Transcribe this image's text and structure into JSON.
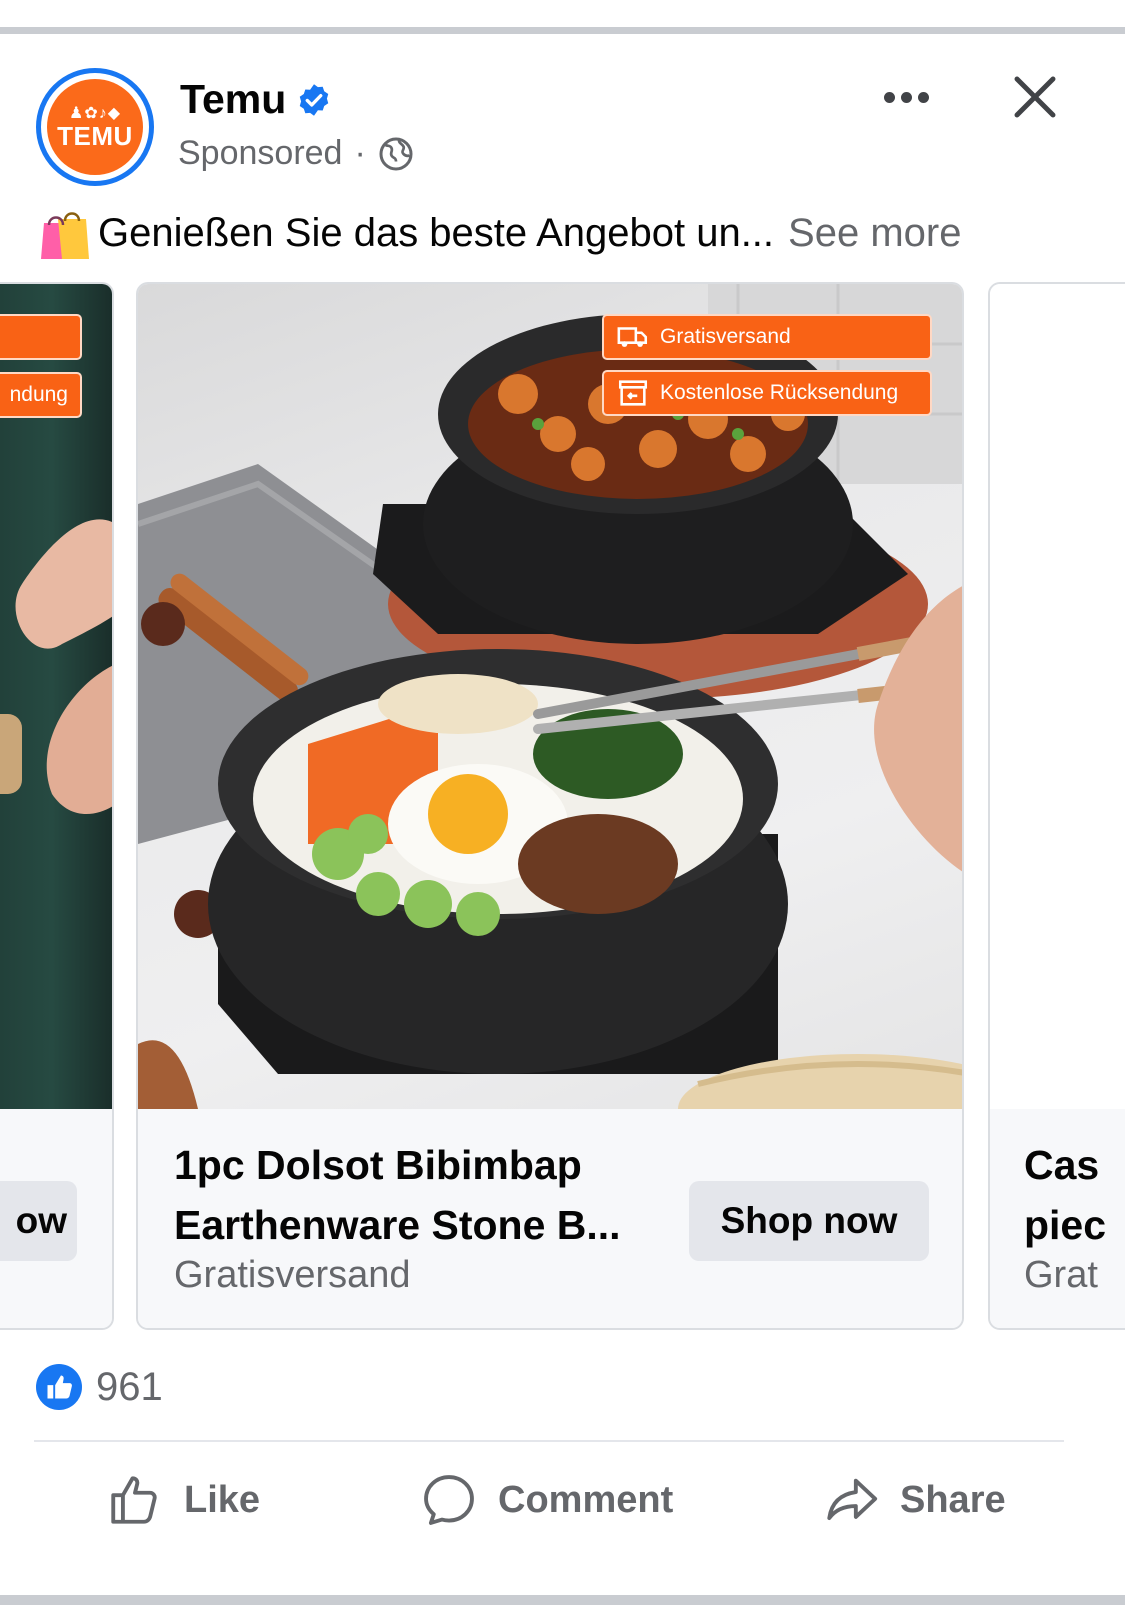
{
  "post": {
    "page_name": "Temu",
    "sponsored_label": "Sponsored",
    "dot": "·",
    "avatar_brand": "TEMU",
    "avatar_glyphs": "♟✿♪◆",
    "text": "Genießen Sie das beste Angebot un...",
    "see_more": "See more"
  },
  "carousel": {
    "left_card": {
      "tag1": "",
      "tag2": "ndung",
      "button": "ow"
    },
    "main_card": {
      "tag_shipping": "Gratisversand",
      "tag_return": "Kostenlose Rücksendung",
      "title_line1": "1pc Dolsot Bibimbap",
      "title_line2": "Earthenware Stone B...",
      "subtitle": "Gratisversand",
      "button": "Shop now"
    },
    "right_card": {
      "title_line1": "Cas",
      "title_line2": "piec",
      "subtitle": "Grat"
    }
  },
  "reactions": {
    "count": "961"
  },
  "actions": {
    "like": "Like",
    "comment": "Comment",
    "share": "Share"
  },
  "colors": {
    "brand_orange": "#fb6a1a",
    "fb_blue": "#1877f2",
    "secondary_text": "#65676b",
    "button_bg": "#e4e6eb"
  }
}
